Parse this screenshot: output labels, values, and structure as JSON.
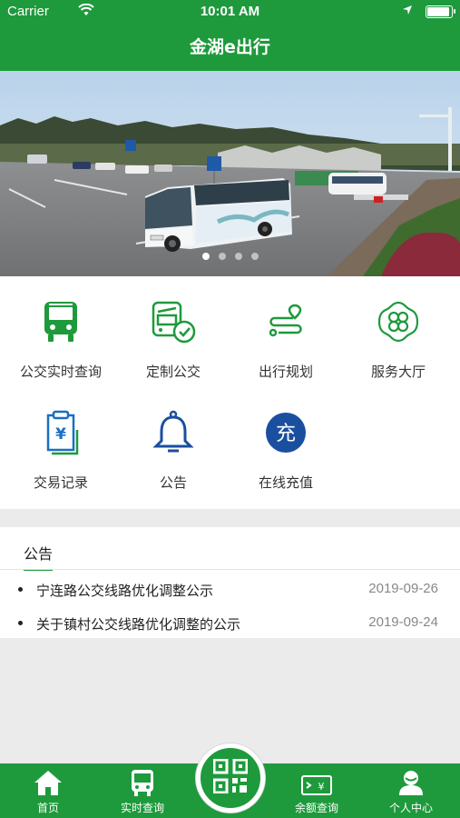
{
  "status_bar": {
    "carrier": "Carrier",
    "time": "10:01 AM"
  },
  "nav": {
    "title": "金湖e出行"
  },
  "banner": {
    "page_count": 4,
    "active_index": 0
  },
  "services": [
    {
      "label": "公交实时查询",
      "icon": "bus-icon",
      "color": "#1e9a3c"
    },
    {
      "label": "定制公交",
      "icon": "custom-bus-icon",
      "color": "#1e9a3c"
    },
    {
      "label": "出行规划",
      "icon": "route-plan-icon",
      "color": "#1e9a3c"
    },
    {
      "label": "服务大厅",
      "icon": "clover-icon",
      "color": "#1e9a3c"
    },
    {
      "label": "交易记录",
      "icon": "receipt-icon",
      "color": "#1a6fc4"
    },
    {
      "label": "公告",
      "icon": "bell-icon",
      "color": "#1a4fa0"
    },
    {
      "label": "在线充值",
      "icon": "recharge-icon",
      "icon_text": "充",
      "color": "#1a4fa0"
    }
  ],
  "notices": {
    "heading": "公告",
    "items": [
      {
        "title": "宁连路公交线路优化调整公示",
        "date": "2019-09-26"
      },
      {
        "title": "关于镇村公交线路优化调整的公示",
        "date": "2019-09-24"
      }
    ]
  },
  "tabbar": {
    "tabs": [
      {
        "label": "首页",
        "icon": "home-icon"
      },
      {
        "label": "实时查询",
        "icon": "bus-front-icon"
      },
      {
        "label": "余额查询",
        "icon": "card-balance-icon"
      },
      {
        "label": "个人中心",
        "icon": "user-icon"
      }
    ],
    "center_icon": "qr-code-icon"
  },
  "colors": {
    "brand_green": "#1e9a3c",
    "blue": "#1a4fa0"
  }
}
